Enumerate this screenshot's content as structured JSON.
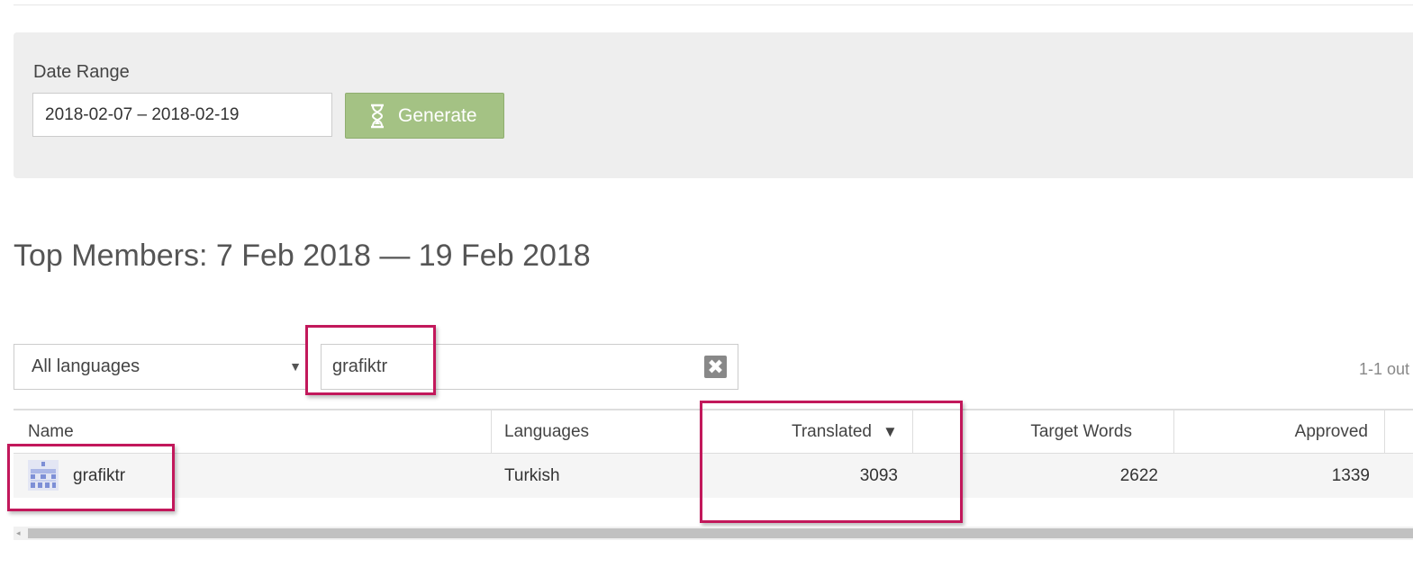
{
  "filters": {
    "date_range_label": "Date Range",
    "date_range_value": "2018-02-07 – 2018-02-19",
    "generate_label": "Generate"
  },
  "report": {
    "title": "Top Members: 7 Feb 2018 — 19 Feb 2018"
  },
  "table_controls": {
    "language_select_value": "All languages",
    "search_value": "grafiktr",
    "clear_icon": "✖",
    "pagination_text": "1-1 out"
  },
  "table": {
    "columns": [
      "Name",
      "Languages",
      "Translated",
      "Target Words",
      "Approved"
    ],
    "sort_indicator": "▼",
    "rows": [
      {
        "name": "grafiktr",
        "languages": "Turkish",
        "translated": "3093",
        "target_words": "2622",
        "approved": "1339"
      }
    ]
  },
  "colors": {
    "highlight": "#c2185b",
    "generate_button": "#a4c284",
    "panel_background": "#eeeeee"
  },
  "icons": {
    "generate": "hourglass-icon",
    "clear": "clear-icon",
    "sort": "sort-desc-icon",
    "avatar": "identicon-avatar"
  }
}
